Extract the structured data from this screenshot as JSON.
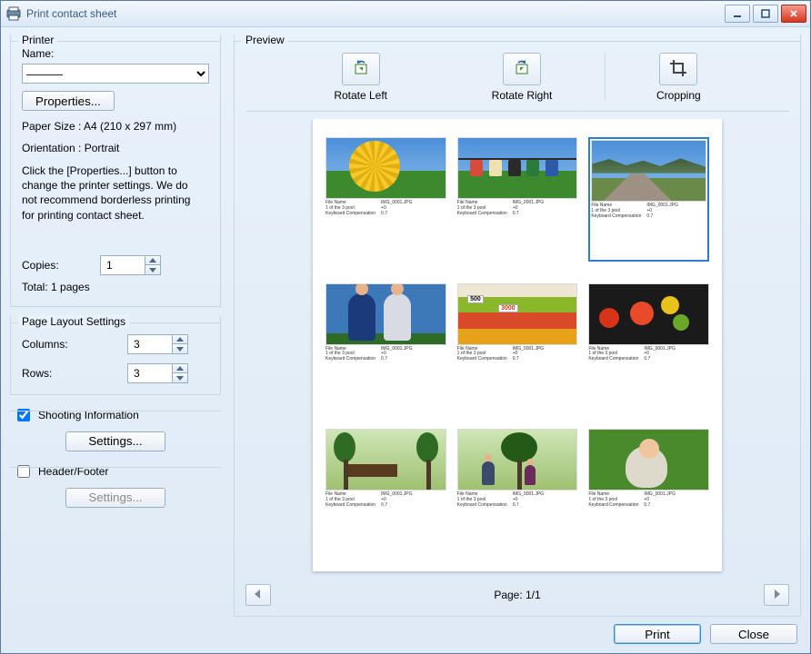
{
  "window": {
    "title": "Print contact sheet"
  },
  "left": {
    "printer": {
      "legend": "Printer",
      "name_label": "Name:",
      "selected_printer": "———",
      "properties_btn": "Properties...",
      "paper_size": "Paper Size : A4 (210 x 297 mm)",
      "orientation": "Orientation : Portrait",
      "hint": "Click the [Properties...] button to change the printer settings. We do not recommend borderless printing for printing contact sheet.",
      "copies_label": "Copies:",
      "copies_value": "1",
      "total_pages": "Total: 1 pages"
    },
    "layout": {
      "legend": "Page Layout Settings",
      "columns_label": "Columns:",
      "columns_value": "3",
      "rows_label": "Rows:",
      "rows_value": "3"
    },
    "shooting": {
      "checkbox_label": "Shooting Information",
      "settings_btn": "Settings..."
    },
    "header_footer": {
      "checkbox_label": "Header/Footer",
      "settings_btn": "Settings..."
    }
  },
  "preview": {
    "legend": "Preview",
    "tools": {
      "rotate_left": "Rotate Left",
      "rotate_right": "Rotate Right",
      "cropping": "Cropping"
    },
    "page_indicator": "Page: 1/1"
  },
  "footer": {
    "print_btn": "Print",
    "close_btn": "Close"
  }
}
